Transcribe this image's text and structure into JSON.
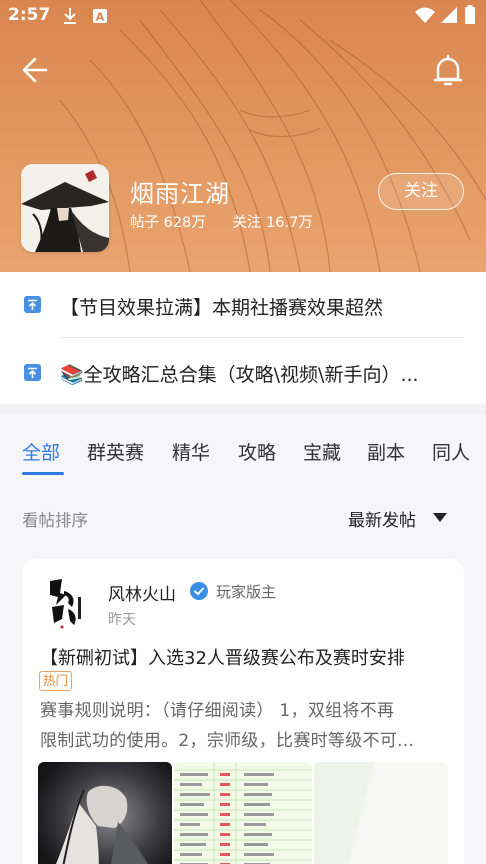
{
  "status_bar": {
    "time": "2:57"
  },
  "forum": {
    "name": "烟雨江湖",
    "posts_label": "帖子 628万",
    "followers_label": "关注 16.7万",
    "follow_button": "关注"
  },
  "pinned": [
    {
      "text": "【节目效果拉满】本期社播赛效果超然"
    },
    {
      "text": "📚全攻略汇总合集（攻略\\视频\\新手向）..."
    }
  ],
  "tabs": [
    {
      "label": "全部",
      "active": true
    },
    {
      "label": "群英赛",
      "active": false
    },
    {
      "label": "精华",
      "active": false
    },
    {
      "label": "攻略",
      "active": false
    },
    {
      "label": "宝藏",
      "active": false
    },
    {
      "label": "副本",
      "active": false
    },
    {
      "label": "同人",
      "active": false
    }
  ],
  "sort": {
    "label": "看帖排序",
    "selected": "最新发帖"
  },
  "post": {
    "author": "风林火山",
    "author_role": "玩家版主",
    "time": "昨天",
    "title": "【新硎初试】入选32人晋级赛公布及赛时安排",
    "badge": "热门",
    "excerpt_line1": "赛事规则说明：（请仔细阅读） 1，双组将不再",
    "excerpt_line2": "限制武功的使用。2，宗师级，比赛时等级不可..."
  },
  "colors": {
    "accent": "#2f7ae5",
    "header": "#e2955e",
    "hot": "#e98a3a"
  },
  "icons": [
    "back-arrow-icon",
    "bell-icon",
    "pin-icon",
    "verified-icon",
    "caret-down-icon",
    "download-icon",
    "wifi-icon",
    "signal-icon",
    "battery-icon"
  ]
}
